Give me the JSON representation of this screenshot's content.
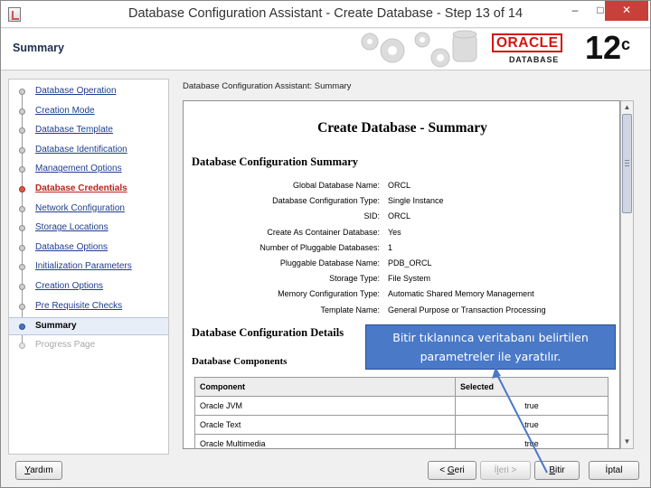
{
  "window": {
    "title": "Database Configuration Assistant - Create Database - Step 13 of 14",
    "controls": [
      "–",
      "□",
      "✕"
    ]
  },
  "header": {
    "section_title": "Summary",
    "brand_name": "ORACLE",
    "brand_product": "DATABASE",
    "version": "12",
    "version_sup": "c"
  },
  "sidebar": {
    "items": [
      {
        "label": "Database Operation",
        "state": "done"
      },
      {
        "label": "Creation Mode",
        "state": "done"
      },
      {
        "label": "Database Template",
        "state": "done"
      },
      {
        "label": "Database Identification",
        "state": "done"
      },
      {
        "label": "Management Options",
        "state": "done"
      },
      {
        "label": "Database Credentials",
        "state": "error"
      },
      {
        "label": "Network Configuration",
        "state": "done"
      },
      {
        "label": "Storage Locations",
        "state": "done"
      },
      {
        "label": "Database Options",
        "state": "done"
      },
      {
        "label": "Initialization Parameters",
        "state": "done"
      },
      {
        "label": "Creation Options",
        "state": "done"
      },
      {
        "label": "Pre Requisite Checks",
        "state": "done"
      },
      {
        "label": "Summary",
        "state": "active"
      },
      {
        "label": "Progress Page",
        "state": "disabled"
      }
    ]
  },
  "content": {
    "label": "Database Configuration Assistant: Summary",
    "doc_title": "Create Database - Summary",
    "summary_heading": "Database Configuration Summary",
    "summary_rows": [
      {
        "key": "Global Database Name:",
        "value": "ORCL"
      },
      {
        "key": "Database Configuration Type:",
        "value": "Single Instance"
      },
      {
        "key": "SID:",
        "value": "ORCL"
      },
      {
        "key": "Create As Container Database:",
        "value": "Yes"
      },
      {
        "key": "Number of Pluggable Databases:",
        "value": "1"
      },
      {
        "key": "Pluggable Database Name:",
        "value": "PDB_ORCL"
      },
      {
        "key": "Storage Type:",
        "value": "File System"
      },
      {
        "key": "Memory Configuration Type:",
        "value": "Automatic Shared Memory Management"
      },
      {
        "key": "Template Name:",
        "value": "General Purpose or Transaction Processing"
      }
    ],
    "details_heading": "Database Configuration Details",
    "components_heading": "Database Components",
    "components_table": {
      "headers": [
        "Component",
        "Selected"
      ],
      "rows": [
        [
          "Oracle JVM",
          "true"
        ],
        [
          "Oracle Text",
          "true"
        ],
        [
          "Oracle Multimedia",
          "true"
        ]
      ]
    }
  },
  "callout": {
    "text_line1": "Bitir tıklanınca veritabanı belirtilen",
    "text_line2": "parametreler ile yaratılır."
  },
  "buttons": {
    "help_mn": "Y",
    "help_rest": "ardım",
    "back_prefix": "< ",
    "back_mn": "G",
    "back_rest": "eri",
    "next_prefix": "İ",
    "next_mn": "l",
    "next_rest": "eri >",
    "finish_mn": "B",
    "finish_rest": "itir",
    "cancel": "İptal"
  },
  "colors": {
    "brand_red": "#d3150f",
    "link_blue": "#1e3d8f",
    "error_red": "#b8241a",
    "callout_blue": "#4a79c8",
    "close_red": "#c7403a"
  }
}
